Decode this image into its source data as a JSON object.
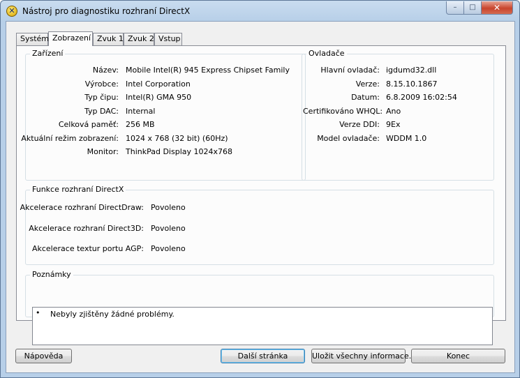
{
  "window": {
    "title": "Nástroj pro diagnostiku rozhraní DirectX"
  },
  "tabs": [
    {
      "label": "Systém"
    },
    {
      "label": "Zobrazení"
    },
    {
      "label": "Zvuk 1"
    },
    {
      "label": "Zvuk 2"
    },
    {
      "label": "Vstup"
    }
  ],
  "device": {
    "title": "Zařízení",
    "rows": [
      {
        "label": "Název:",
        "value": "Mobile Intel(R) 945 Express Chipset Family"
      },
      {
        "label": "Výrobce:",
        "value": "Intel Corporation"
      },
      {
        "label": "Typ čipu:",
        "value": "Intel(R) GMA 950"
      },
      {
        "label": "Typ DAC:",
        "value": "Internal"
      },
      {
        "label": "Celková paměť:",
        "value": "256 MB"
      },
      {
        "label": "Aktuální režim zobrazení:",
        "value": "1024 x 768 (32 bit) (60Hz)"
      },
      {
        "label": "Monitor:",
        "value": "ThinkPad Display 1024x768"
      }
    ]
  },
  "drivers": {
    "title": "Ovladače",
    "rows": [
      {
        "label": "Hlavní ovladač:",
        "value": "igdumd32.dll"
      },
      {
        "label": "Verze:",
        "value": "8.15.10.1867"
      },
      {
        "label": "Datum:",
        "value": "6.8.2009 16:02:54"
      },
      {
        "label": "Certifikováno WHQL:",
        "value": "Ano"
      },
      {
        "label": "Verze DDI:",
        "value": "9Ex"
      },
      {
        "label": "Model ovladače:",
        "value": "WDDM 1.0"
      }
    ]
  },
  "features": {
    "title": "Funkce rozhraní DirectX",
    "rows": [
      {
        "label": "Akcelerace rozhraní DirectDraw:",
        "value": "Povoleno"
      },
      {
        "label": "Akcelerace rozhraní Direct3D:",
        "value": "Povoleno"
      },
      {
        "label": "Akcelerace textur portu AGP:",
        "value": "Povoleno"
      }
    ]
  },
  "notes": {
    "title": "Poznámky",
    "items": [
      {
        "bullet": "•",
        "text": "Nebyly zjištěny žádné problémy."
      }
    ]
  },
  "buttons": {
    "help": "Nápověda",
    "next_page": "Další stránka",
    "save_all": "Uložit všechny informace...",
    "exit": "Konec"
  },
  "title_controls": {
    "minimize": "–",
    "maximize": "□",
    "close": "✕",
    "app_icon": "✕"
  },
  "colors": {
    "title_bar": "#b7cfe8",
    "close_button": "#c8442c",
    "panel": "#fcfcfc"
  }
}
